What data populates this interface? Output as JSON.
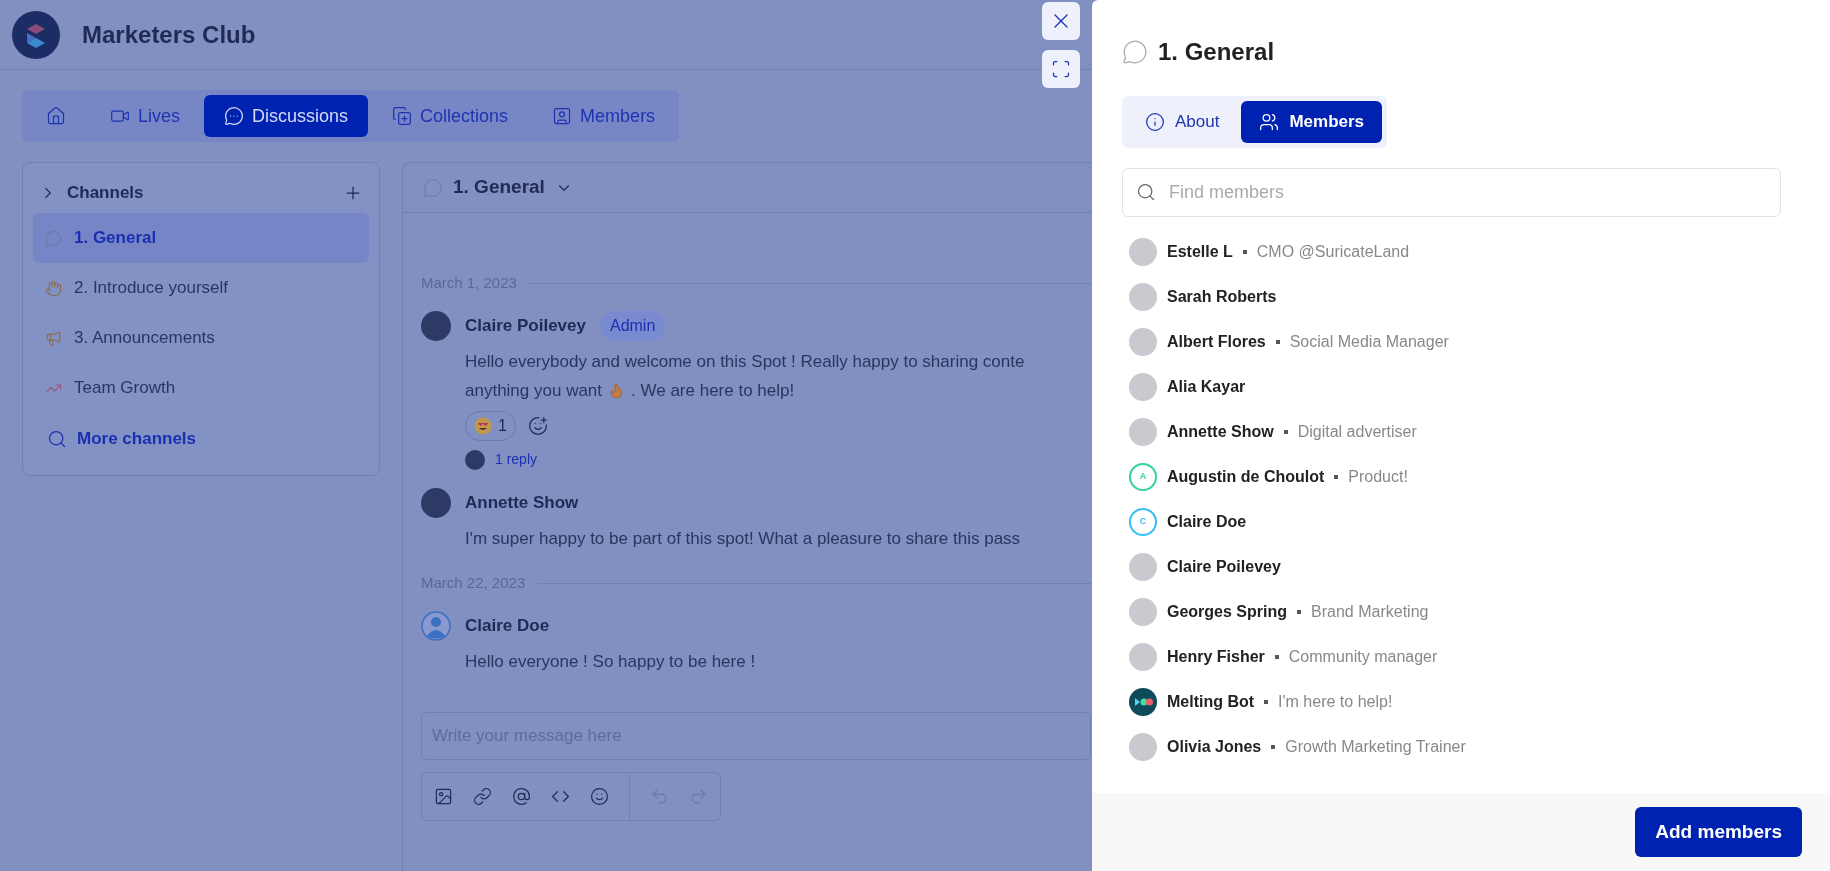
{
  "header": {
    "title": "Marketers Club"
  },
  "nav": [
    {
      "kind": "home",
      "selected": false
    },
    {
      "kind": "video",
      "label": "Lives",
      "selected": false
    },
    {
      "kind": "chat",
      "label": "Discussions",
      "selected": true
    },
    {
      "kind": "collection",
      "label": "Collections",
      "selected": false
    },
    {
      "kind": "members",
      "label": "Members",
      "selected": false
    }
  ],
  "sidebar": {
    "title": "Channels",
    "channels": [
      {
        "kind": "bubble",
        "label": "1. General",
        "selected": true
      },
      {
        "kind": "hand",
        "label": "2. Introduce yourself",
        "selected": false
      },
      {
        "kind": "megaphone",
        "label": "3. Announcements",
        "selected": false
      },
      {
        "kind": "chart",
        "label": "Team Growth",
        "selected": false
      }
    ],
    "more": "More channels"
  },
  "main": {
    "channel": "1. General",
    "groups": [
      {
        "date": "March 1, 2023",
        "messages": [
          {
            "author": "Claire Poilevey",
            "avatar": {
              "kind": "photo"
            },
            "badge": "Admin",
            "lines": [
              {
                "text": "Hello everybody and welcome on this Spot ! Really happy to sharing conte"
              },
              {
                "text": "anything you want",
                "emoji": {
                  "kind": "fire"
                },
                "after": ". We are here to help!"
              }
            ],
            "reactions": [
              {
                "emoji": {
                  "kind": "heart-eyes"
                },
                "count": "1"
              }
            ],
            "replies": "1 reply"
          },
          {
            "author": "Annette Show",
            "avatar": {
              "kind": "photo"
            },
            "lines": [
              {
                "text": "I'm super happy to be part of this spot! What a pleasure to share this pass"
              }
            ]
          }
        ]
      },
      {
        "date": "March 22, 2023",
        "messages": [
          {
            "author": "Claire Doe",
            "avatar": {
              "kind": "default"
            },
            "lines": [
              {
                "text": "Hello everyone ! So happy to be here !"
              }
            ]
          }
        ]
      }
    ],
    "composer": {
      "placeholder": "Write your message here"
    },
    "toolbar": [
      {
        "kind": "image",
        "disabled": false
      },
      {
        "kind": "link",
        "disabled": false
      },
      {
        "kind": "at",
        "disabled": false
      },
      {
        "kind": "code",
        "disabled": false
      },
      {
        "kind": "emoji",
        "disabled": false
      },
      {
        "kind": "undo",
        "disabled": true
      },
      {
        "kind": "redo",
        "disabled": true
      }
    ]
  },
  "panel": {
    "title": "1. General",
    "tabs": [
      {
        "kind": "info",
        "label": "About",
        "selected": false
      },
      {
        "kind": "members",
        "label": "Members",
        "selected": true
      }
    ],
    "search": {
      "placeholder": "Find members"
    },
    "members": [
      {
        "name": "Estelle L",
        "role": "CMO @SuricateLand",
        "avatar": {
          "kind": "photo"
        }
      },
      {
        "name": "Sarah Roberts",
        "avatar": {
          "kind": "photo"
        }
      },
      {
        "name": "Albert Flores",
        "role": "Social Media Manager",
        "avatar": {
          "kind": "photo"
        }
      },
      {
        "name": "Alia Kayar",
        "avatar": {
          "kind": "photo"
        }
      },
      {
        "name": "Annette Show",
        "role": "Digital advertiser",
        "avatar": {
          "kind": "photo"
        }
      },
      {
        "name": "Augustin de Choulot",
        "role": "Product!",
        "avatar": {
          "kind": "initial",
          "initial": "A",
          "color": "#34d399"
        }
      },
      {
        "name": "Claire Doe",
        "avatar": {
          "kind": "initial",
          "initial": "C",
          "color": "#38bdf8"
        }
      },
      {
        "name": "Claire Poilevey",
        "avatar": {
          "kind": "photo"
        }
      },
      {
        "name": "Georges Spring",
        "role": "Brand Marketing",
        "avatar": {
          "kind": "photo"
        }
      },
      {
        "name": "Henry Fisher",
        "role": "Community manager",
        "avatar": {
          "kind": "photo"
        }
      },
      {
        "name": "Melting Bot",
        "role": "I'm here to help!",
        "avatar": {
          "kind": "bot"
        }
      },
      {
        "name": "Olivia Jones",
        "role": "Growth Marketing Trainer",
        "avatar": {
          "kind": "photo"
        }
      }
    ],
    "add_button": "Add members"
  }
}
